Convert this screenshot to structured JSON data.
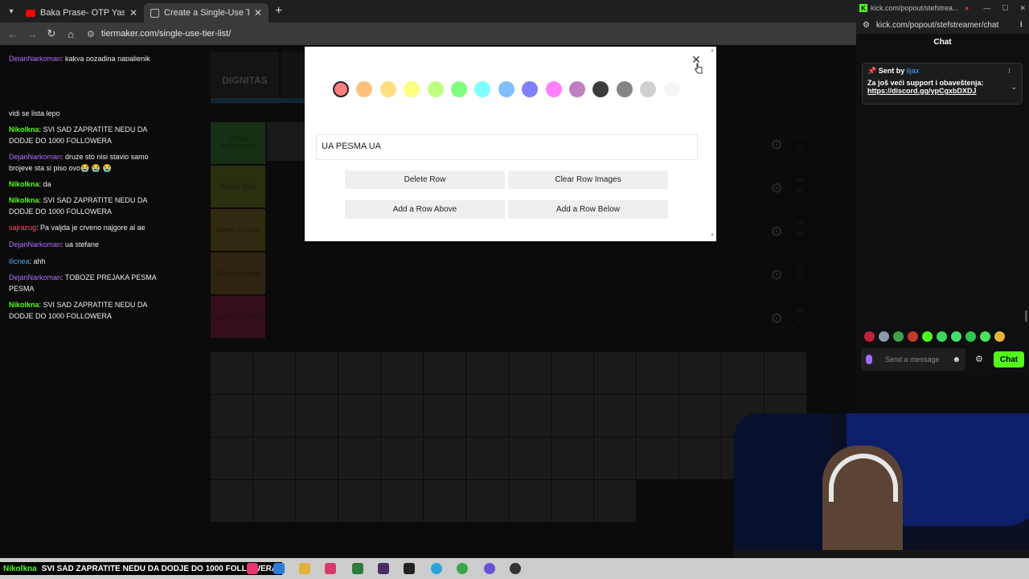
{
  "browser": {
    "tabs": [
      {
        "title": "Baka Prase- OTP Yasuo REMASTER",
        "close": "✕"
      },
      {
        "title": "Create a Single-Use Tier List (P",
        "close": "✕"
      }
    ],
    "new_tab": "+",
    "url": "tiermaker.com/single-use-tier-list/"
  },
  "page": {
    "logo_text": "DIGNITAS",
    "tiers": [
      {
        "label": "CRNI PROSTOR",
        "color": "#163016"
      },
      {
        "label": "SAMA BEE",
        "color": "#2b2f10"
      },
      {
        "label": "Mesto za plac",
        "color": "#302a10"
      },
      {
        "label": "Zivot kaskada",
        "color": "#2e2410"
      },
      {
        "label": "Uzasno u CRNO",
        "color": "#35101b"
      }
    ]
  },
  "modal": {
    "colors": [
      "#ff7f7f",
      "#ffbf7f",
      "#ffdf7f",
      "#ffff7f",
      "#bfff7f",
      "#7fff7f",
      "#7fffff",
      "#7fbfff",
      "#7f7fff",
      "#ff7fff",
      "#bf7fbf",
      "#3b3b3b",
      "#858585",
      "#cfcfcf",
      "#f7f7f7"
    ],
    "selected_index": 0,
    "row_name": "UA PESMA UA",
    "buttons": {
      "delete_row": "Delete Row",
      "clear_row_images": "Clear Row Images",
      "add_row_above": "Add a Row Above",
      "add_row_below": "Add a Row Below"
    },
    "close": "✕"
  },
  "kick": {
    "window_url": "kick.com/popout/stefstrea...",
    "url": "kick.com/popout/stefstreamer/chat",
    "header": "Chat",
    "partial_top": {
      "user": "DejanNarkoman",
      "text": ": kakva pozadina napaljenik"
    },
    "pinned": {
      "sent_by": "Sent by",
      "user": "lijax",
      "text": "Za još veći support i obaveštenja:",
      "link": "https://discord.gg/ypCgxbDXDJ"
    },
    "messages": [
      {
        "user": "",
        "text": "vidi se lista lepo",
        "color": "g"
      },
      {
        "user": "Nikolkna",
        "text": ": SVI SAD ZAPRATITE NEDU DA DODJE DO 1000 FOLLOWERA",
        "color": "g"
      },
      {
        "user": "DejanNarkoman",
        "text": ": druze sto nisi stavio samo brojeve sta si piso ovo😭 😭 😭",
        "color": "p"
      },
      {
        "user": "Nikolkna",
        "text": ": da",
        "color": "g"
      },
      {
        "user": "Nikolkna",
        "text": ": SVI SAD ZAPRATITE NEDU DA DODJE DO 1000 FOLLOWERA",
        "color": "g"
      },
      {
        "user": "sajrazug",
        "text": ": Pa valjda je crveno najgore al ae",
        "color": "r"
      },
      {
        "user": "DejanNarkoman",
        "text": ": ua stefane",
        "color": "p"
      },
      {
        "user": "ilicnea",
        "text": ": ahh",
        "color": "b"
      },
      {
        "user": "DejanNarkoman",
        "text": ": TOBOZE PREJAKA PESMA PESMA",
        "color": "p"
      },
      {
        "user": "Nikolkna",
        "text": ": SVI SAD ZAPRATITE NEDU DA DODJE DO 1000 FOLLOWERA",
        "color": "g"
      }
    ],
    "input_placeholder": "Send a message",
    "send_label": "Chat",
    "accent": "#53fc18"
  },
  "ticker": {
    "user": "Nikolkna",
    "text": "SVI SAD ZAPRATITE NEDU DA DODJE DO 1000 FOLLOWERA"
  }
}
